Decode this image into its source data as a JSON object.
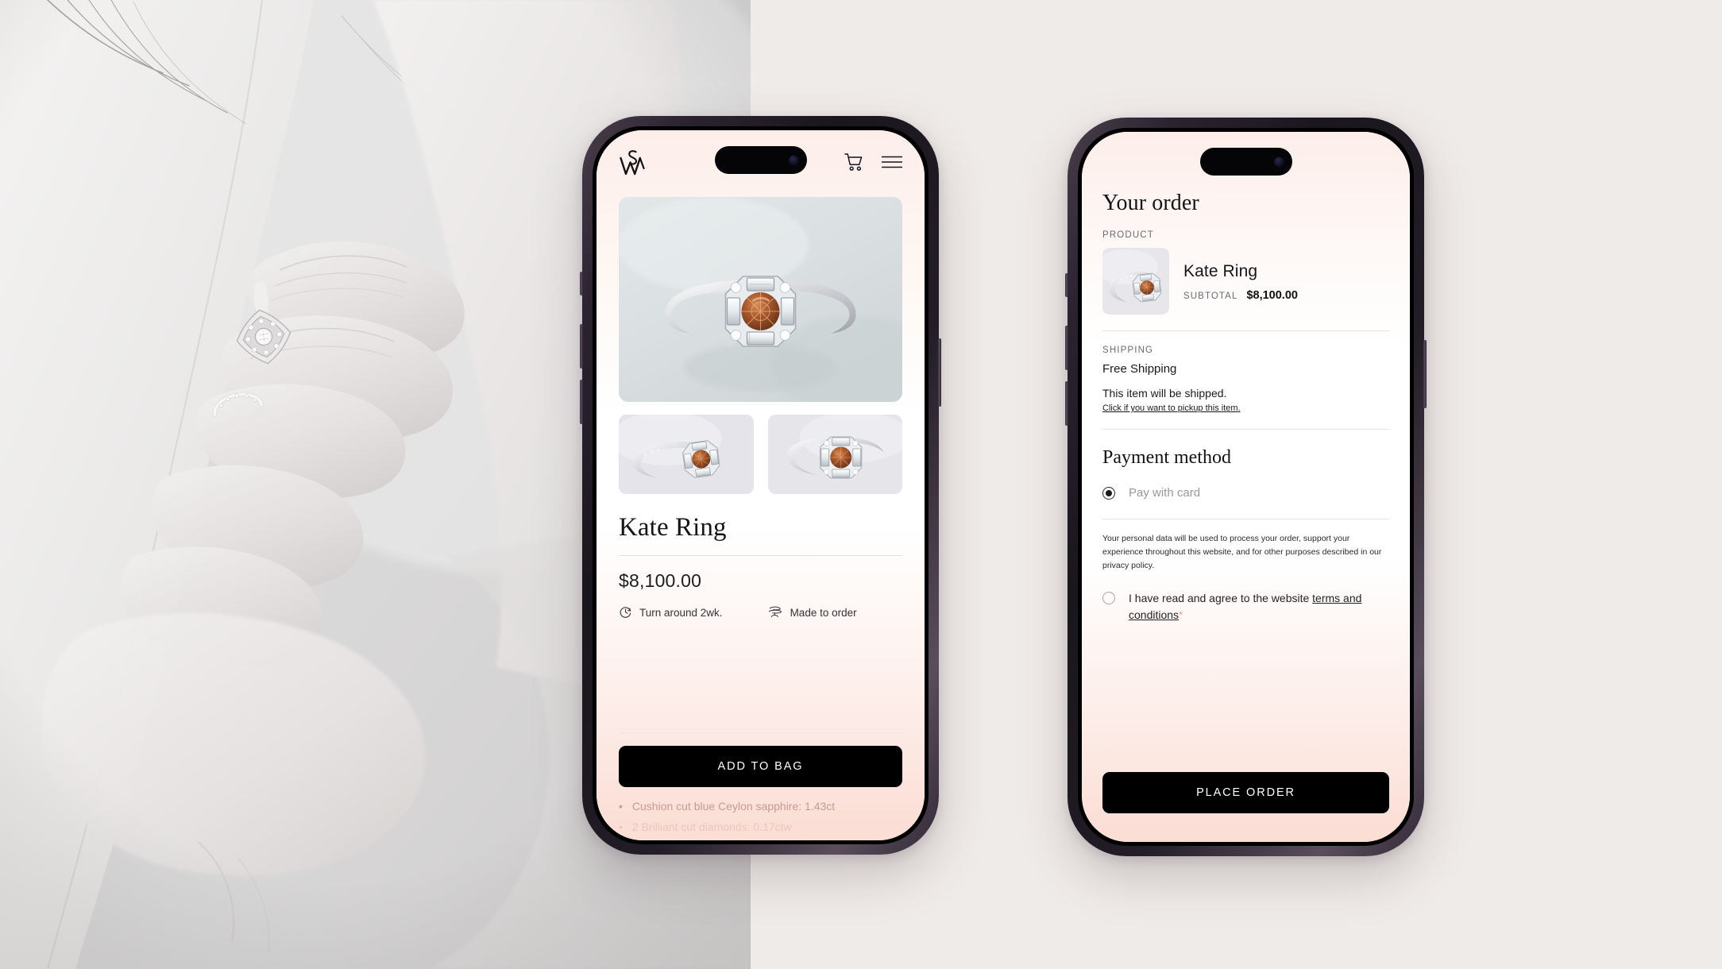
{
  "brand": {
    "monogram": "SW"
  },
  "pdp": {
    "header": {
      "cart_icon": "shopping-cart-icon",
      "menu_icon": "hamburger-menu-icon"
    },
    "gallery": {
      "main_alt": "Kate Ring octagonal art deco engagement ring",
      "thumbs": [
        {
          "alt": "Kate Ring side angle view"
        },
        {
          "alt": "Kate Ring three quarter view"
        }
      ]
    },
    "title": "Kate Ring",
    "price": "$8,100.00",
    "meta": [
      {
        "icon": "clock-turnaround-icon",
        "label": "Turn around 2wk."
      },
      {
        "icon": "anvil-icon",
        "label": "Made to order"
      }
    ],
    "cta": "ADD TO BAG",
    "specs": [
      "Cushion cut blue Ceylon sapphire: 1.43ct",
      "2 Brilliant cut diamonds: 0.17ctw"
    ]
  },
  "checkout": {
    "heading": "Your order",
    "product_label": "PRODUCT",
    "product_name": "Kate Ring",
    "subtotal_label": "SUBTOTAL",
    "subtotal_value": "$8,100.00",
    "shipping_label": "SHIPPING",
    "shipping_method": "Free Shipping",
    "shipping_note": "This item will be shipped.",
    "pickup_link": "Click if you want to pickup this item.",
    "payment_heading": "Payment method",
    "payment_option": "Pay with card",
    "privacy_text": "Your personal data will be used to process your order, support your experience throughout this website, and for other purposes described in our privacy policy.",
    "terms_prefix": "I have read and agree to the website ",
    "terms_link": "terms and conditions",
    "terms_star": "*",
    "cta": "PLACE ORDER"
  },
  "colors": {
    "page_bg": "#efebe8",
    "blush": "#fbddd4",
    "accent_pink": "#e8a695",
    "ink": "#000000",
    "frame": "#2b2430"
  }
}
